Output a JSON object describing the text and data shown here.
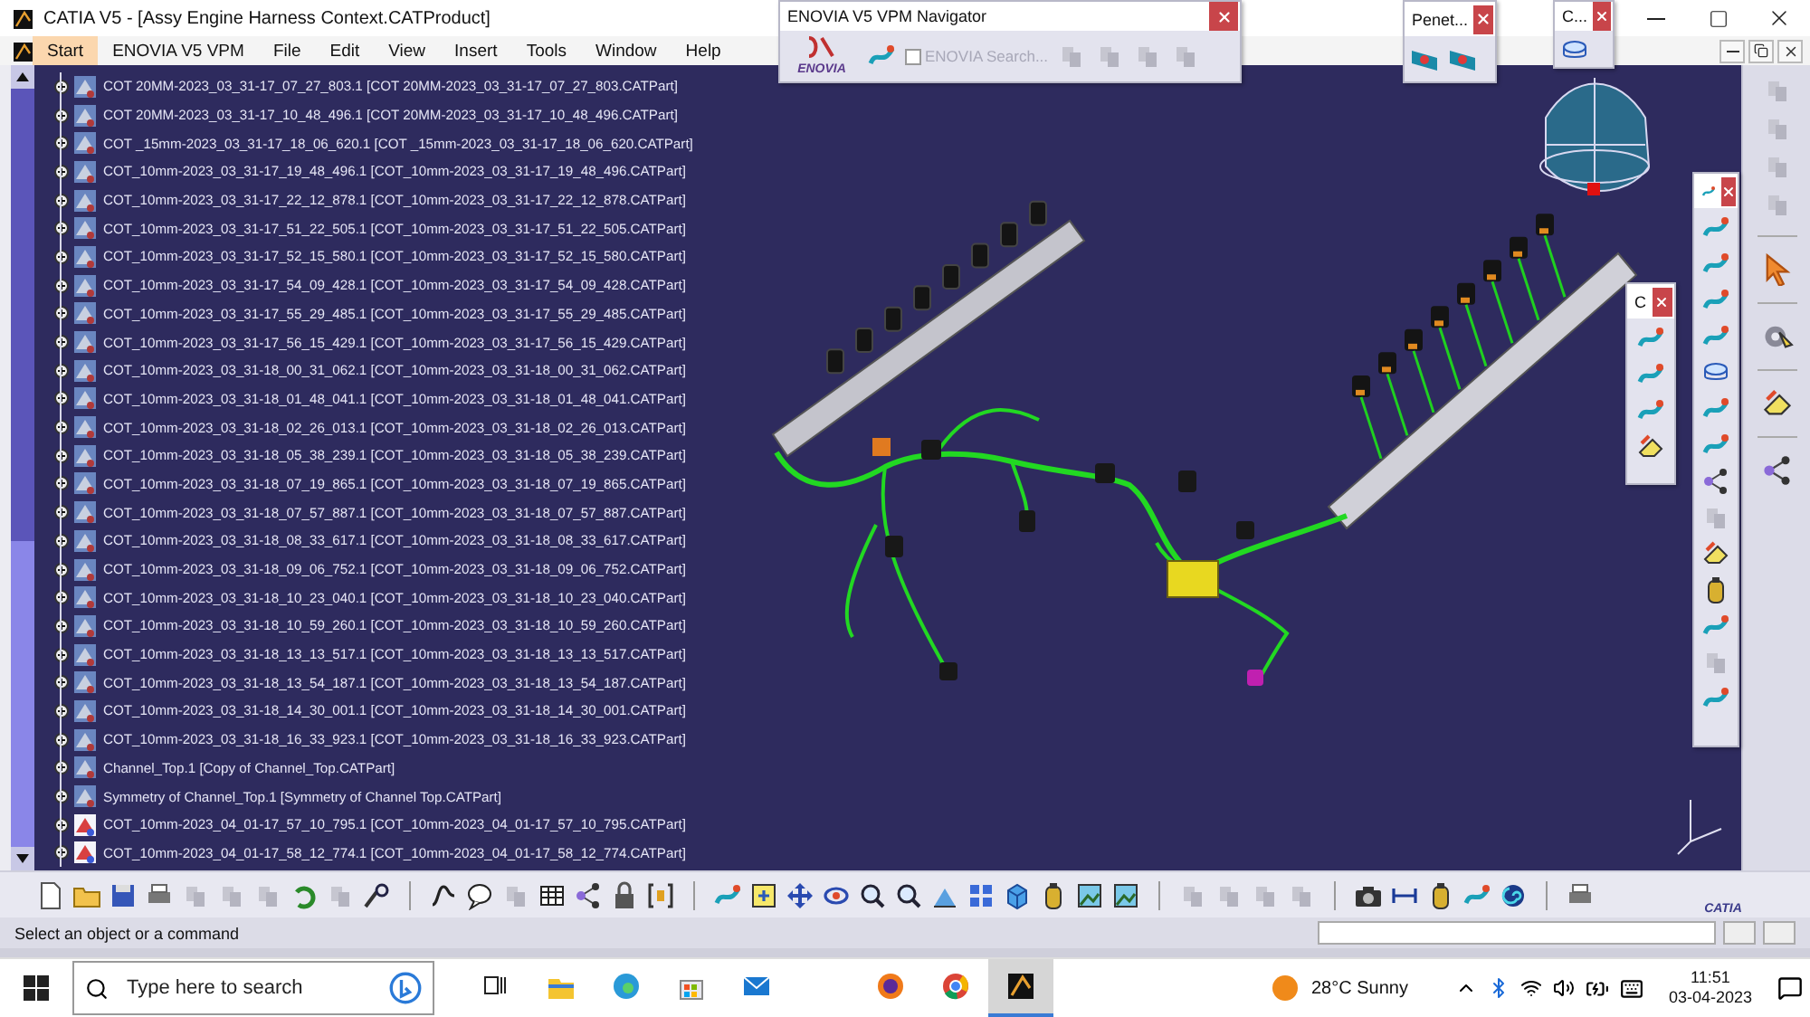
{
  "window": {
    "title": "CATIA V5 - [Assy Engine Harness Context.CATProduct]"
  },
  "menu": [
    {
      "label": "Start",
      "selected": true
    },
    {
      "label": "ENOVIA V5 VPM",
      "selected": false
    },
    {
      "label": "File",
      "selected": false
    },
    {
      "label": "Edit",
      "selected": false
    },
    {
      "label": "View",
      "selected": false
    },
    {
      "label": "Insert",
      "selected": false
    },
    {
      "label": "Tools",
      "selected": false
    },
    {
      "label": "Window",
      "selected": false
    },
    {
      "label": "Help",
      "selected": false
    }
  ],
  "enovia_toolbar": {
    "title": "ENOVIA V5 VPM Navigator",
    "logo": "ENOVIA",
    "search": {
      "label": "ENOVIA Search...",
      "checked": false,
      "disabled": true
    }
  },
  "penetration_toolbar": {
    "title": "Penet..."
  },
  "small_toolbar": {
    "title": "C..."
  },
  "harness_toolbar": {
    "title": "C"
  },
  "tree": {
    "items": [
      {
        "label": "COT 20MM-2023_03_31-17_07_27_803.1 [COT 20MM-2023_03_31-17_07_27_803.CATPart]",
        "kind": "part"
      },
      {
        "label": "COT 20MM-2023_03_31-17_10_48_496.1 [COT 20MM-2023_03_31-17_10_48_496.CATPart]",
        "kind": "part"
      },
      {
        "label": "COT _15mm-2023_03_31-17_18_06_620.1 [COT _15mm-2023_03_31-17_18_06_620.CATPart]",
        "kind": "part"
      },
      {
        "label": "COT_10mm-2023_03_31-17_19_48_496.1 [COT_10mm-2023_03_31-17_19_48_496.CATPart]",
        "kind": "part"
      },
      {
        "label": "COT_10mm-2023_03_31-17_22_12_878.1 [COT_10mm-2023_03_31-17_22_12_878.CATPart]",
        "kind": "part"
      },
      {
        "label": "COT_10mm-2023_03_31-17_51_22_505.1 [COT_10mm-2023_03_31-17_51_22_505.CATPart]",
        "kind": "part"
      },
      {
        "label": "COT_10mm-2023_03_31-17_52_15_580.1 [COT_10mm-2023_03_31-17_52_15_580.CATPart]",
        "kind": "part"
      },
      {
        "label": "COT_10mm-2023_03_31-17_54_09_428.1 [COT_10mm-2023_03_31-17_54_09_428.CATPart]",
        "kind": "part"
      },
      {
        "label": "COT_10mm-2023_03_31-17_55_29_485.1 [COT_10mm-2023_03_31-17_55_29_485.CATPart]",
        "kind": "part"
      },
      {
        "label": "COT_10mm-2023_03_31-17_56_15_429.1 [COT_10mm-2023_03_31-17_56_15_429.CATPart]",
        "kind": "part"
      },
      {
        "label": "COT_10mm-2023_03_31-18_00_31_062.1 [COT_10mm-2023_03_31-18_00_31_062.CATPart]",
        "kind": "part"
      },
      {
        "label": "COT_10mm-2023_03_31-18_01_48_041.1 [COT_10mm-2023_03_31-18_01_48_041.CATPart]",
        "kind": "part"
      },
      {
        "label": "COT_10mm-2023_03_31-18_02_26_013.1 [COT_10mm-2023_03_31-18_02_26_013.CATPart]",
        "kind": "part"
      },
      {
        "label": "COT_10mm-2023_03_31-18_05_38_239.1 [COT_10mm-2023_03_31-18_05_38_239.CATPart]",
        "kind": "part"
      },
      {
        "label": "COT_10mm-2023_03_31-18_07_19_865.1 [COT_10mm-2023_03_31-18_07_19_865.CATPart]",
        "kind": "part"
      },
      {
        "label": "COT_10mm-2023_03_31-18_07_57_887.1 [COT_10mm-2023_03_31-18_07_57_887.CATPart]",
        "kind": "part"
      },
      {
        "label": "COT_10mm-2023_03_31-18_08_33_617.1 [COT_10mm-2023_03_31-18_08_33_617.CATPart]",
        "kind": "part"
      },
      {
        "label": "COT_10mm-2023_03_31-18_09_06_752.1 [COT_10mm-2023_03_31-18_09_06_752.CATPart]",
        "kind": "part"
      },
      {
        "label": "COT_10mm-2023_03_31-18_10_23_040.1 [COT_10mm-2023_03_31-18_10_23_040.CATPart]",
        "kind": "part"
      },
      {
        "label": "COT_10mm-2023_03_31-18_10_59_260.1 [COT_10mm-2023_03_31-18_10_59_260.CATPart]",
        "kind": "part"
      },
      {
        "label": "COT_10mm-2023_03_31-18_13_13_517.1 [COT_10mm-2023_03_31-18_13_13_517.CATPart]",
        "kind": "part"
      },
      {
        "label": "COT_10mm-2023_03_31-18_13_54_187.1 [COT_10mm-2023_03_31-18_13_54_187.CATPart]",
        "kind": "part"
      },
      {
        "label": "COT_10mm-2023_03_31-18_14_30_001.1 [COT_10mm-2023_03_31-18_14_30_001.CATPart]",
        "kind": "part"
      },
      {
        "label": "COT_10mm-2023_03_31-18_16_33_923.1 [COT_10mm-2023_03_31-18_16_33_923.CATPart]",
        "kind": "part"
      },
      {
        "label": "Channel_Top.1 [Copy of Channel_Top.CATPart]",
        "kind": "part"
      },
      {
        "label": "Symmetry of Channel_Top.1 [Symmetry of Channel Top.CATPart]",
        "kind": "part"
      },
      {
        "label": "COT_10mm-2023_04_01-17_57_10_795.1 [COT_10mm-2023_04_01-17_57_10_795.CATPart]",
        "kind": "new_part"
      },
      {
        "label": "COT_10mm-2023_04_01-17_58_12_774.1 [COT_10mm-2023_04_01-17_58_12_774.CATPart]",
        "kind": "new_part"
      }
    ]
  },
  "catia_logo": "CATIA",
  "status_bar": {
    "prompt": "Select an object or a command"
  },
  "taskbar": {
    "search_placeholder": "Type here to search",
    "apps": [
      {
        "kind": "task_view",
        "selected": false
      },
      {
        "kind": "files",
        "selected": false
      },
      {
        "kind": "edge",
        "selected": false
      },
      {
        "kind": "store",
        "selected": false
      },
      {
        "kind": "mail",
        "selected": false
      },
      {
        "kind": "firefox",
        "selected": false
      },
      {
        "kind": "chrome",
        "selected": false
      },
      {
        "kind": "catia",
        "selected": true
      }
    ],
    "weather": "28°C  Sunny",
    "time": "11:51",
    "date": "03-04-2023"
  }
}
